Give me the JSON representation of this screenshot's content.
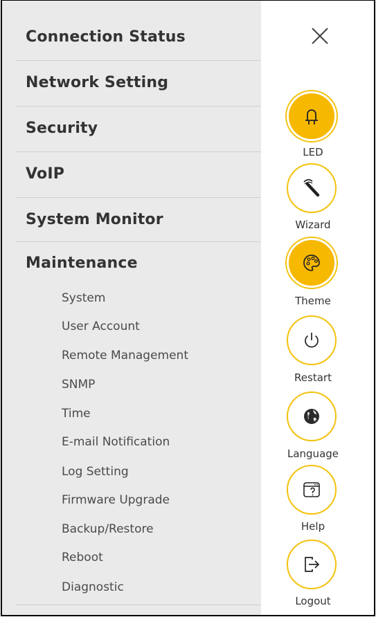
{
  "menu": {
    "sections": [
      {
        "label": "Connection Status"
      },
      {
        "label": "Network Setting"
      },
      {
        "label": "Security"
      },
      {
        "label": "VoIP"
      },
      {
        "label": "System Monitor"
      },
      {
        "label": "Maintenance"
      }
    ],
    "maintenance_items": [
      "System",
      "User Account",
      "Remote Management",
      "SNMP",
      "Time",
      "E-mail Notification",
      "Log Setting",
      "Firmware Upgrade",
      "Backup/Restore",
      "Reboot",
      "Diagnostic"
    ]
  },
  "quick_actions": [
    {
      "label": "LED",
      "icon": "led-icon",
      "active": true
    },
    {
      "label": "Wizard",
      "icon": "wizard-icon",
      "active": false
    },
    {
      "label": "Theme",
      "icon": "theme-palette-icon",
      "active": true
    },
    {
      "label": "Restart",
      "icon": "power-icon",
      "active": false
    },
    {
      "label": "Language",
      "icon": "globe-icon",
      "active": false
    },
    {
      "label": "Help",
      "icon": "help-icon",
      "active": false
    },
    {
      "label": "Logout",
      "icon": "logout-icon",
      "active": false
    }
  ],
  "colors": {
    "accent": "#f7b800",
    "accent_border": "#f3c20c",
    "menu_bg": "#eaeaea"
  }
}
